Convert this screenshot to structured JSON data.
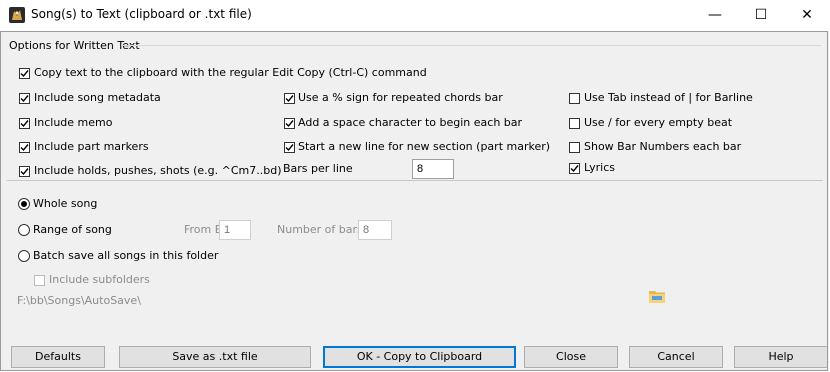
{
  "window": {
    "title": "Song(s) to Text (clipboard or .txt file)",
    "controls": {
      "minimize": "—",
      "maximize": "☐",
      "close": "✕"
    }
  },
  "options": {
    "group_label": "Options for Written Text",
    "copy_clipboard": {
      "label": "Copy text to the clipboard with the regular Edit Copy (Ctrl-C) command",
      "checked": true
    },
    "col1": [
      {
        "label": "Include song metadata",
        "checked": true
      },
      {
        "label": "Include memo",
        "checked": true
      },
      {
        "label": "Include part markers",
        "checked": true
      },
      {
        "label": "Include holds, pushes, shots (e.g. ^Cm7..bd)",
        "checked": true
      }
    ],
    "col2": [
      {
        "label": "Use a % sign for repeated chords bar",
        "checked": true
      },
      {
        "label": "Add a space character to begin each bar",
        "checked": true
      },
      {
        "label": "Start a new line for new section (part marker)",
        "checked": true
      }
    ],
    "bars_per_line": {
      "label": "Bars per line",
      "value": "8"
    },
    "col3": [
      {
        "label": "Use Tab instead of | for Barline",
        "checked": false
      },
      {
        "label": "Use / for every empty beat",
        "checked": false
      },
      {
        "label": "Show Bar Numbers each bar",
        "checked": false
      },
      {
        "label": "Lyrics",
        "checked": true
      }
    ]
  },
  "scope": {
    "whole_song": {
      "label": "Whole song",
      "selected": true
    },
    "range": {
      "label": "Range of song",
      "selected": false,
      "from_bar_label": "From Bar",
      "from_bar_value": "1",
      "num_bars_label": "Number of bars",
      "num_bars_value": "8"
    },
    "batch": {
      "label": "Batch save all songs in this folder",
      "selected": false
    },
    "include_subfolders": {
      "label": "Include subfolders",
      "checked": false
    },
    "folder_path": "F:\\bb\\Songs\\AutoSave\\"
  },
  "buttons": {
    "defaults": "Defaults",
    "save_txt": "Save as .txt file",
    "ok_copy": "OK - Copy to Clipboard",
    "close": "Close",
    "cancel": "Cancel",
    "help": "Help"
  },
  "icons": {
    "app": "band-in-a-box-icon",
    "folder": "folder-icon",
    "check": "checkmark-icon"
  },
  "colors": {
    "default_button_border": "#0078d7",
    "dialog_bg": "#f0f0f0"
  }
}
